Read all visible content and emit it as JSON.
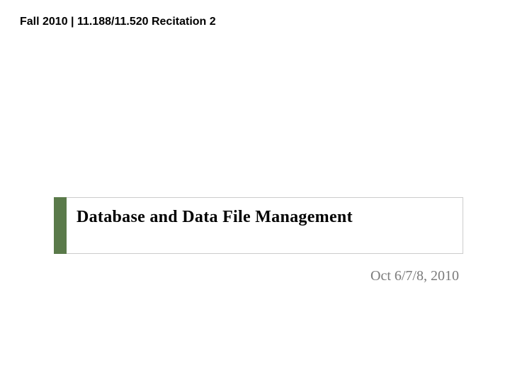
{
  "header": {
    "text": "Fall 2010 | 11.188/11.520 Recitation 2"
  },
  "title": {
    "text": "Database and Data File Management"
  },
  "date": {
    "text": "Oct 6/7/8, 2010"
  },
  "accent_color": "#5a7a4a"
}
